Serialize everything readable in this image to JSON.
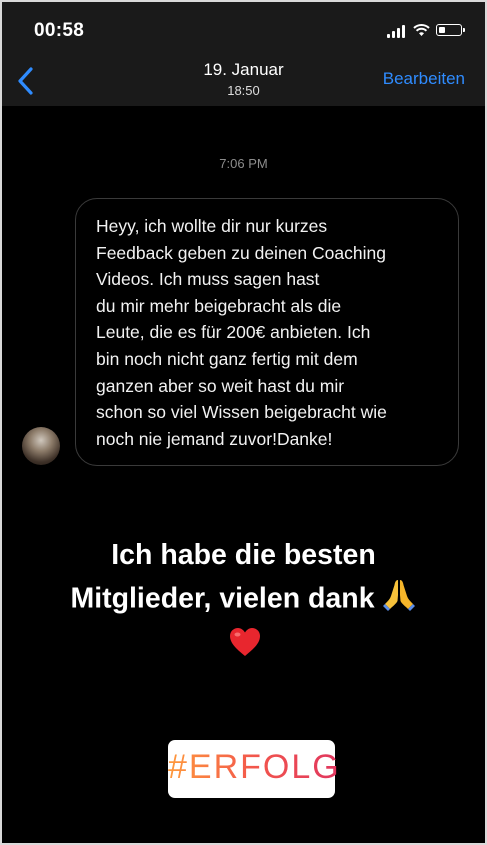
{
  "status_bar": {
    "time": "00:58",
    "battery_level": 0.3
  },
  "nav": {
    "date": "19. Januar",
    "time": "18:50",
    "edit_label": "Bearbeiten"
  },
  "chat": {
    "timestamp": "7:06 PM",
    "message": "Heyy, ich wollte dir nur kurzes\nFeedback geben zu deinen Coaching\nVideos. Ich muss sagen    hast\ndu mir mehr beigebracht als die\nLeute, die es für 200€ anbieten. Ich\nbin noch nicht ganz fertig mit dem\nganzen aber so weit hast du mir\nschon so viel Wissen beigebracht wie\nnoch nie jemand zuvor!Danke!"
  },
  "overlay": {
    "caption": "Ich habe die besten\nMitglieder, vielen dank",
    "hashtag": "#ERFOLG"
  },
  "icons": {
    "back": "chevron-left-icon",
    "signal": "cellular-signal-icon",
    "wifi": "wifi-icon",
    "battery": "battery-icon",
    "pray": "folded-hands-emoji",
    "heart": "red-heart-emoji"
  },
  "colors": {
    "accent_blue": "#2f8cff",
    "bubble_border": "#3a3a3a",
    "hashtag_gradient": [
      "#ff9a3c",
      "#e0355f"
    ]
  }
}
